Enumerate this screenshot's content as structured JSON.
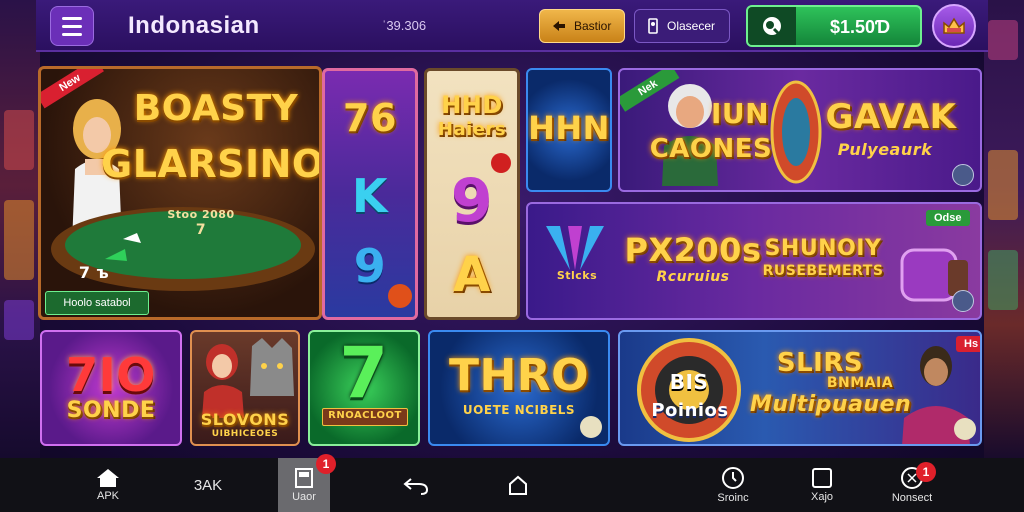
{
  "header": {
    "app_title": "Indonasian",
    "small_value": "ˈ39.306",
    "gold_button_label": "Bastior",
    "dark_button_label": "Olasecer",
    "balance": "$1.50Ɗ"
  },
  "tiles": {
    "casino": {
      "corner_tag": "New",
      "title_line1": "BOASTY",
      "title_line2": "GLARSINO",
      "table_text": "Stoo 2080",
      "table_num": "7",
      "button_label": "Hoolo satabol",
      "chips_text": "7 ъ"
    },
    "slots_col": {
      "symbols": [
        "76",
        "K",
        "9"
      ]
    },
    "hhd_col": {
      "title_line1": "HHD",
      "title_line2": "Haiers",
      "symbols": [
        "9",
        "A"
      ]
    },
    "hhn": {
      "title": "HHN"
    },
    "iun": {
      "corner_tag": "Nek",
      "title_line1": "IUN",
      "title_line2": "CAONES",
      "side_title": "GAVAK",
      "side_sub": "Pulyeaurk"
    },
    "px200": {
      "tag": "Odse",
      "left_text": "Stlcks",
      "title_line1": "PX200s",
      "title_line2": "Rcuruius",
      "side_line1": "SHUNOIY",
      "side_line2": "RUSEBEMERTS"
    },
    "tio": {
      "title_line1": "7IO",
      "title_line2": "SONDE"
    },
    "wolf": {
      "title_line1": "SLOVONS",
      "title_line2": "UIBHICEOES"
    },
    "seven": {
      "title": "7",
      "sub": "RNOACLOOT"
    },
    "thro": {
      "title": "THRO",
      "sub": "UOETE NCIBELS"
    },
    "slirs": {
      "tag": "Hs",
      "wheel_line1": "BIS",
      "wheel_line2": "Poinios",
      "title_line1": "SLIRS",
      "title_line2": "BNMAIA",
      "title_line3": "Multipuauen"
    }
  },
  "bottom_nav": {
    "items": [
      {
        "label": "APK",
        "icon": "home-icon"
      },
      {
        "label": "3AK",
        "icon": ""
      },
      {
        "label": "Uaor",
        "icon": "book-icon",
        "badge": "1"
      },
      {
        "label": "",
        "icon": "undo-icon"
      },
      {
        "label": "",
        "icon": "share-icon"
      },
      {
        "label": "Sroinc",
        "icon": "clock-icon"
      },
      {
        "label": "Xajo",
        "icon": "square-icon"
      },
      {
        "label": "Nonsect",
        "icon": "bell-icon",
        "badge": "1"
      }
    ]
  },
  "colors": {
    "top_bar": "#2b1060",
    "balance_green": "#2ec25a",
    "gold": "#ffd24a",
    "badge_red": "#e0202a"
  }
}
